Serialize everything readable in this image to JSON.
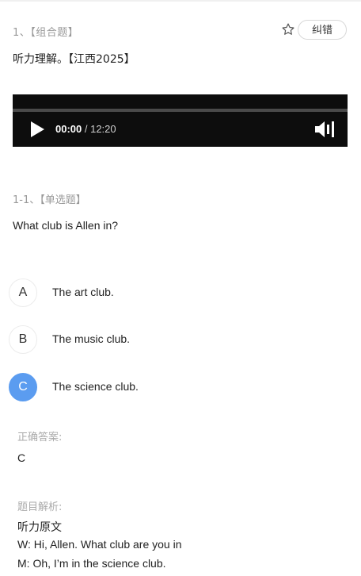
{
  "question": {
    "header": "1、【组合题】",
    "report_label": "纠错",
    "stem": "听力理解。【江西2025】"
  },
  "player": {
    "current_time": "00:00",
    "separator": " / ",
    "total_time": "12:20",
    "progress_fraction": 0.0
  },
  "sub_question": {
    "header": "1-1、【单选题】",
    "text": "What club is Allen in?",
    "options": [
      {
        "letter": "A",
        "text": "The art club.",
        "selected": false
      },
      {
        "letter": "B",
        "text": "The music club.",
        "selected": false
      },
      {
        "letter": "C",
        "text": "The science club.",
        "selected": true
      }
    ]
  },
  "answer": {
    "label": "正确答案:",
    "value": "C"
  },
  "analysis": {
    "label": "题目解析:",
    "title": "听力原文",
    "lines": [
      "W: Hi, Allen. What club are you in",
      "M: Oh, I’m in the science club."
    ]
  },
  "colors": {
    "accent": "#5b9cf0",
    "muted": "#999999",
    "player_bg": "#0d0d0d"
  },
  "icons": {
    "favorite": "star-outline-icon",
    "play": "play-icon",
    "volume": "volume-icon"
  }
}
